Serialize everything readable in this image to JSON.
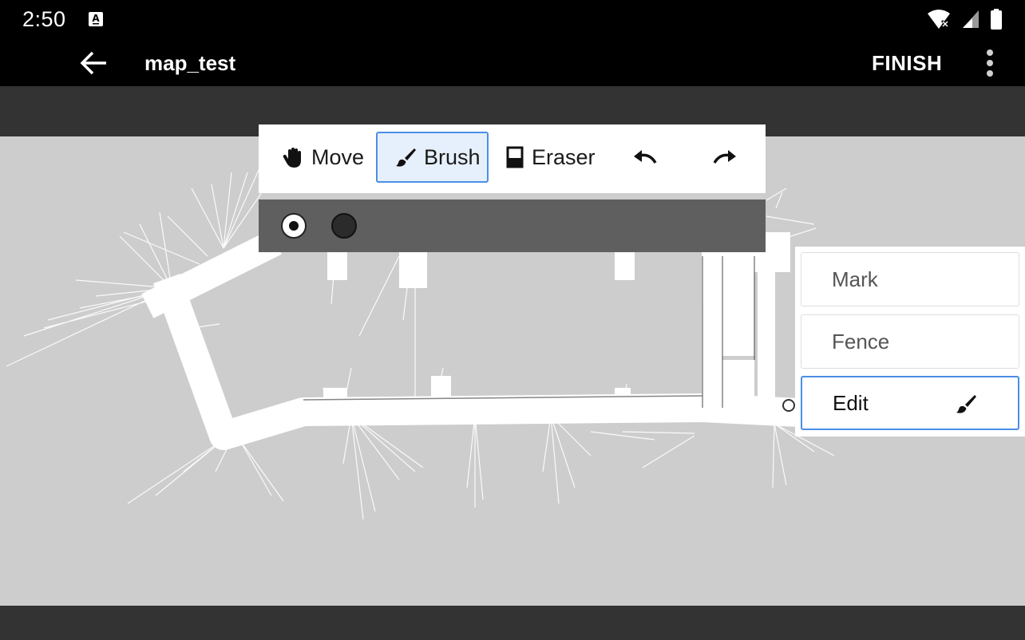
{
  "status_bar": {
    "time": "2:50",
    "icons": [
      "keyboard-a-icon",
      "wifi-off-icon",
      "signal-icon",
      "battery-icon"
    ]
  },
  "app_bar": {
    "title": "map_test",
    "finish_label": "FINISH",
    "icons": [
      "back-arrow-icon",
      "more-vert-icon"
    ]
  },
  "toolbar": {
    "tools": [
      {
        "label": "Move",
        "icon": "hand-icon",
        "selected": false
      },
      {
        "label": "Brush",
        "icon": "brush-icon",
        "selected": true
      },
      {
        "label": "Eraser",
        "icon": "eraser-icon",
        "selected": false
      }
    ],
    "undo_icon": "undo-icon",
    "redo_icon": "redo-icon"
  },
  "brush_sizes": {
    "options": [
      "small",
      "large"
    ],
    "selected": "small"
  },
  "side_panel": {
    "items": [
      {
        "label": "Mark",
        "selected": false
      },
      {
        "label": "Fence",
        "selected": false
      },
      {
        "label": "Edit",
        "selected": true,
        "icon": "brush-icon"
      }
    ]
  },
  "colors": {
    "accent": "#4c8ee6",
    "selected_bg": "#e6f0fc",
    "map_background": "#cdcdcd",
    "bars": "#000000",
    "bands": "#333333"
  }
}
